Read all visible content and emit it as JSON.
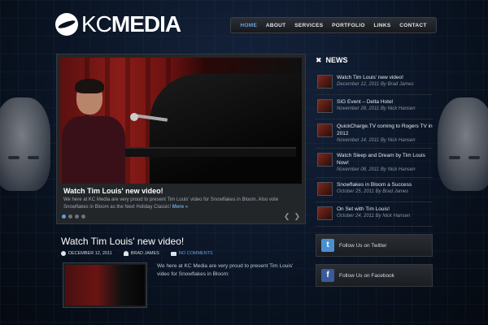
{
  "brand": {
    "kc": "KC",
    "media": "MEDIA"
  },
  "nav": {
    "items": [
      {
        "label": "HOME",
        "active": true
      },
      {
        "label": "ABOUT"
      },
      {
        "label": "SERVICES"
      },
      {
        "label": "PORTFOLIO"
      },
      {
        "label": "LINKS"
      },
      {
        "label": "CONTACT"
      }
    ],
    "accent": "#6aa3e0"
  },
  "slider": {
    "title": "Watch Tim Louis' new video!",
    "text": "We here at KC Media are very proud to present Tim Louis' video for Snowflakes in Bloom.  Also vote Snowflakes in Bloom as the Next Holiday Classic!",
    "more": "More »",
    "dots": 4,
    "active_dot": 1,
    "prev_icon": "chevron-left-icon",
    "next_icon": "chevron-right-icon"
  },
  "post": {
    "title": "Watch Tim Louis' new video!",
    "date": "DECEMBER 12, 2011",
    "author": "BRAD JAMES",
    "comments": "NO COMMENTS",
    "excerpt": "We here at KC Media are very proud to present Tim Louis' video for Snowflakes in Bloom:"
  },
  "sidebar": {
    "news_title": "NEWS",
    "news": [
      {
        "title": "Watch Tim Louis' new video!",
        "meta": "December 12, 2011 By Brad James"
      },
      {
        "title": "SIG Event – Delta Hotel",
        "meta": "November 28, 2011 By Nick Hansen"
      },
      {
        "title": "QuickCharge.TV coming to Rogers TV in 2012",
        "meta": "November 14, 2011 By Nick Hansen"
      },
      {
        "title": "Watch Sleep and Dream by Tim Louis Now!",
        "meta": "November 08, 2011 By Nick Hansen"
      },
      {
        "title": "Snowflakes in Bloom a Success",
        "meta": "October 25, 2011 By Brad James"
      },
      {
        "title": "On Set with Tim Louis!",
        "meta": "October 24, 2011 By Nick Hansen"
      }
    ],
    "twitter_label": "Follow Us on Twitter",
    "facebook_label": "Follow Us on Facebook"
  }
}
